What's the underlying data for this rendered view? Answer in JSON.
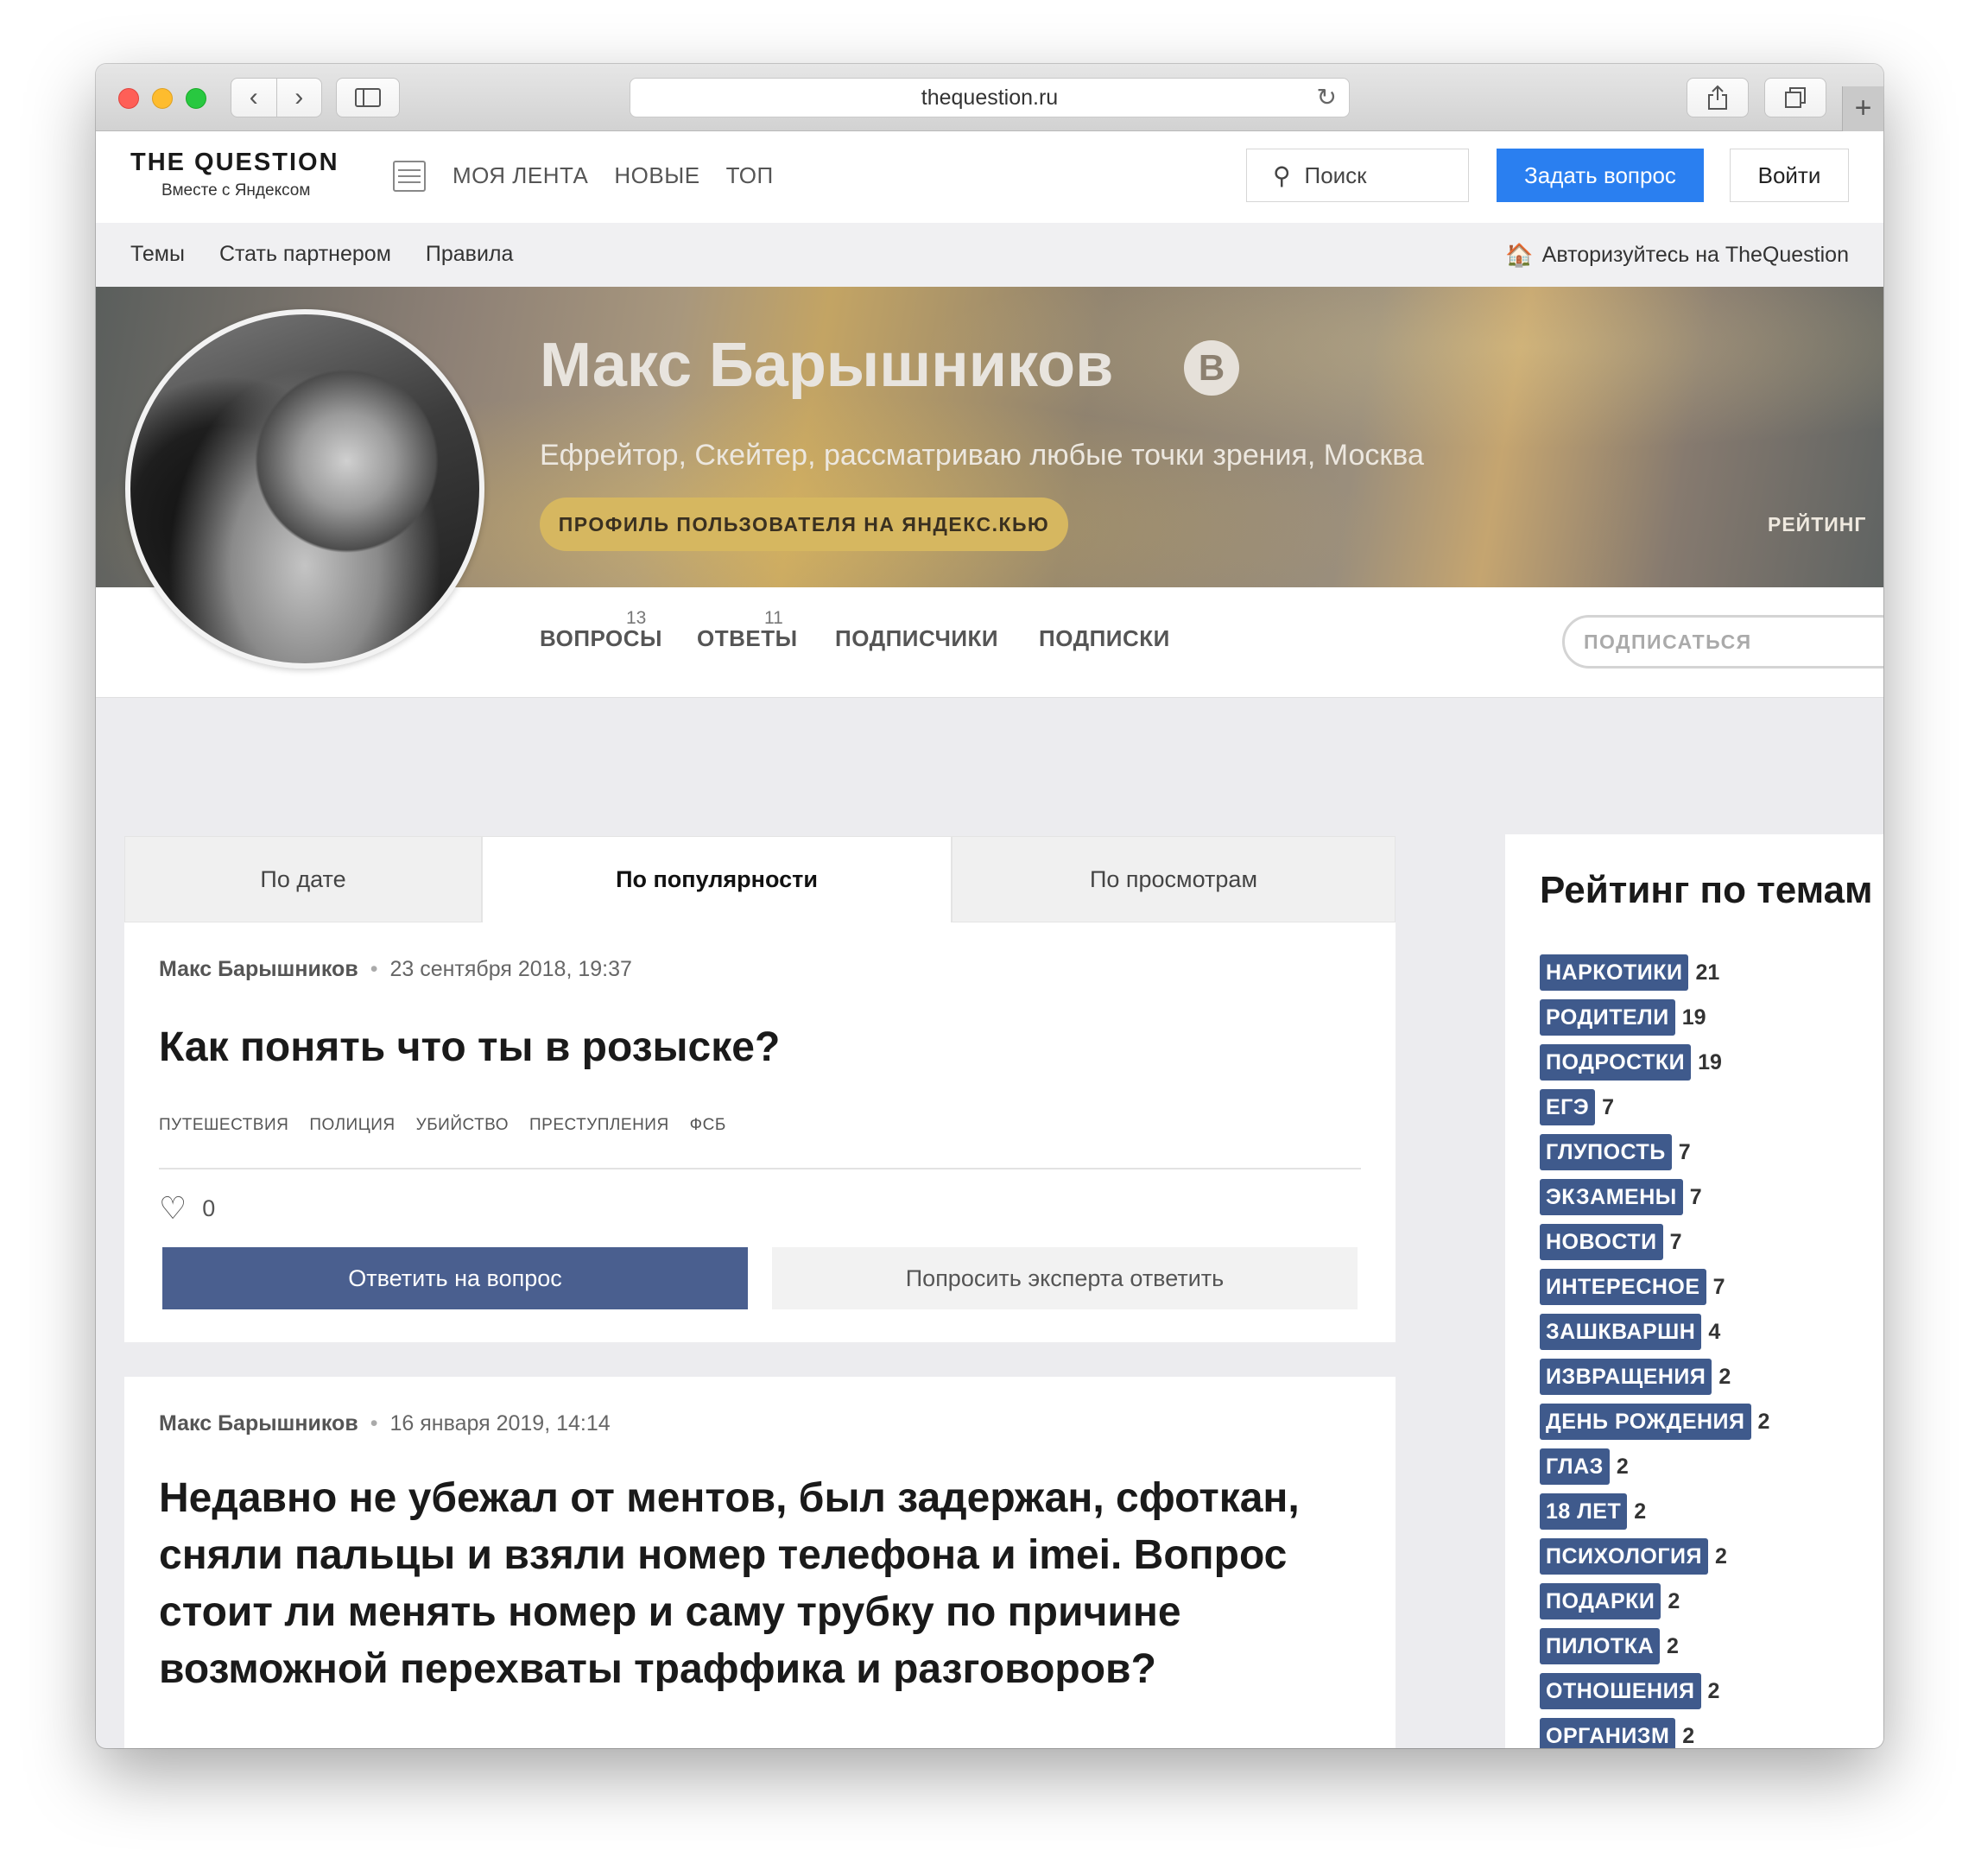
{
  "browser": {
    "url": "thequestion.ru"
  },
  "header": {
    "logo_title": "THE QUESTION",
    "logo_subtitle": "Вместе с Яндексом",
    "nav": [
      "МОЯ ЛЕНТА",
      "НОВЫЕ",
      "ТОП"
    ],
    "search_placeholder": "Поиск",
    "ask_button": "Задать вопрос",
    "login_button": "Войти"
  },
  "subnav": {
    "links": [
      "Темы",
      "Стать партнером",
      "Правила"
    ],
    "auth_link": "Авторизуйтесь на TheQuestion"
  },
  "profile": {
    "name": "Макс Барышников",
    "badge": "B",
    "description": "Ефрейтор, Скейтер, рассматриваю любые точки зрения, Москва",
    "yandex_button": "ПРОФИЛЬ ПОЛЬЗОВАТЕЛЯ НА ЯНДЕКС.КЬЮ",
    "rating_label": "РЕЙТИНГ",
    "stats": {
      "questions_label": "ВОПРОСЫ",
      "questions_count": "13",
      "answers_label": "ОТВЕТЫ",
      "answers_count": "11",
      "followers_label": "ПОДПИСЧИКИ",
      "following_label": "ПОДПИСКИ"
    },
    "subscribe_button": "ПОДПИСАТЬСЯ"
  },
  "tabs": [
    "По дате",
    "По популярности",
    "По просмотрам"
  ],
  "active_tab": "По популярности",
  "questions": [
    {
      "author": "Макс Барышников",
      "date": "23 сентября 2018, 19:37",
      "title": "Как понять что ты в розыске?",
      "topics": [
        "ПУТЕШЕСТВИЯ",
        "ПОЛИЦИЯ",
        "УБИЙСТВО",
        "ПРЕСТУПЛЕНИЯ",
        "ФСБ"
      ],
      "likes": "0",
      "answer_button": "Ответить на вопрос",
      "expert_button": "Попросить эксперта ответить"
    },
    {
      "author": "Макс Барышников",
      "date": "16 января 2019, 14:14",
      "title": "Недавно не убежал от ментов, был задержан, сфоткан, сняли пальцы и взяли номер телефона и imei. Вопрос стоит ли менять номер и саму трубку по причине возможной перехваты траффика и разговоров?"
    }
  ],
  "topic_rating": {
    "title": "Рейтинг по темам",
    "items": [
      {
        "tag": "НАРКОТИКИ",
        "count": "21"
      },
      {
        "tag": "РОДИТЕЛИ",
        "count": "19"
      },
      {
        "tag": "ПОДРОСТКИ",
        "count": "19"
      },
      {
        "tag": "ЕГЭ",
        "count": "7"
      },
      {
        "tag": "ГЛУПОСТЬ",
        "count": "7"
      },
      {
        "tag": "ЭКЗАМЕНЫ",
        "count": "7"
      },
      {
        "tag": "НОВОСТИ",
        "count": "7"
      },
      {
        "tag": "ИНТЕРЕСНОЕ",
        "count": "7"
      },
      {
        "tag": "ЗАШКВАРШН",
        "count": "4"
      },
      {
        "tag": "ИЗВРАЩЕНИЯ",
        "count": "2"
      },
      {
        "tag": "ДЕНЬ РОЖДЕНИЯ",
        "count": "2"
      },
      {
        "tag": "ГЛАЗ",
        "count": "2"
      },
      {
        "tag": "18 ЛЕТ",
        "count": "2"
      },
      {
        "tag": "ПСИХОЛОГИЯ",
        "count": "2"
      },
      {
        "tag": "ПОДАРКИ",
        "count": "2"
      },
      {
        "tag": "ПИЛОТКА",
        "count": "2"
      },
      {
        "tag": "ОТНОШЕНИЯ",
        "count": "2"
      },
      {
        "tag": "ОРГАНИЗМ",
        "count": "2"
      }
    ]
  },
  "colors": {
    "ask_button": "#2a7ff0",
    "answer_button": "#4a5f8f",
    "tag_background": "#3f5a8c",
    "yandex_button": "#d6b760"
  }
}
